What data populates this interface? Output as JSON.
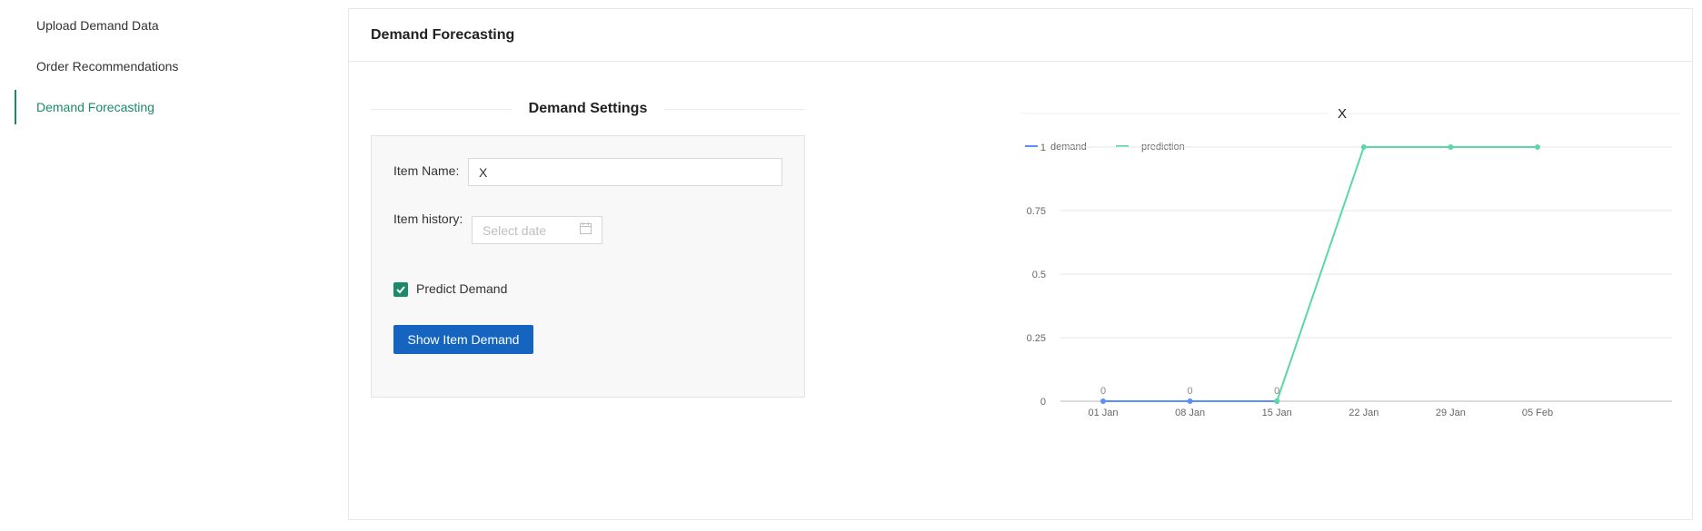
{
  "sidebar": {
    "items": [
      {
        "label": "Upload Demand Data"
      },
      {
        "label": "Order Recommendations"
      },
      {
        "label": "Demand Forecasting"
      }
    ]
  },
  "card": {
    "title": "Demand Forecasting"
  },
  "settings": {
    "title": "Demand Settings",
    "item_name_label": "Item Name:",
    "item_name_value": "X",
    "item_history_label": "Item history:",
    "date_placeholder": "Select date",
    "predict_label": "Predict Demand",
    "predict_checked": true,
    "show_button": "Show Item Demand"
  },
  "colors": {
    "accent": "#1a8a6a",
    "button": "#1565c0",
    "demand": "#5b8ff9",
    "prediction": "#5ad8a6"
  },
  "chart_data": {
    "type": "line",
    "title": "X",
    "categories": [
      "01 Jan",
      "08 Jan",
      "15 Jan",
      "22 Jan",
      "29 Jan",
      "05 Feb"
    ],
    "series": [
      {
        "name": "demand",
        "values": [
          0,
          0,
          0,
          null,
          null,
          null
        ],
        "labels": [
          "0",
          "0",
          "0"
        ]
      },
      {
        "name": "prediction",
        "values": [
          null,
          null,
          0,
          1,
          1,
          1
        ]
      }
    ],
    "yticks": [
      "0",
      "0.25",
      "0.5",
      "0.75",
      "1"
    ],
    "ylim": [
      0,
      1
    ],
    "grid": true,
    "legend": "top-left"
  }
}
